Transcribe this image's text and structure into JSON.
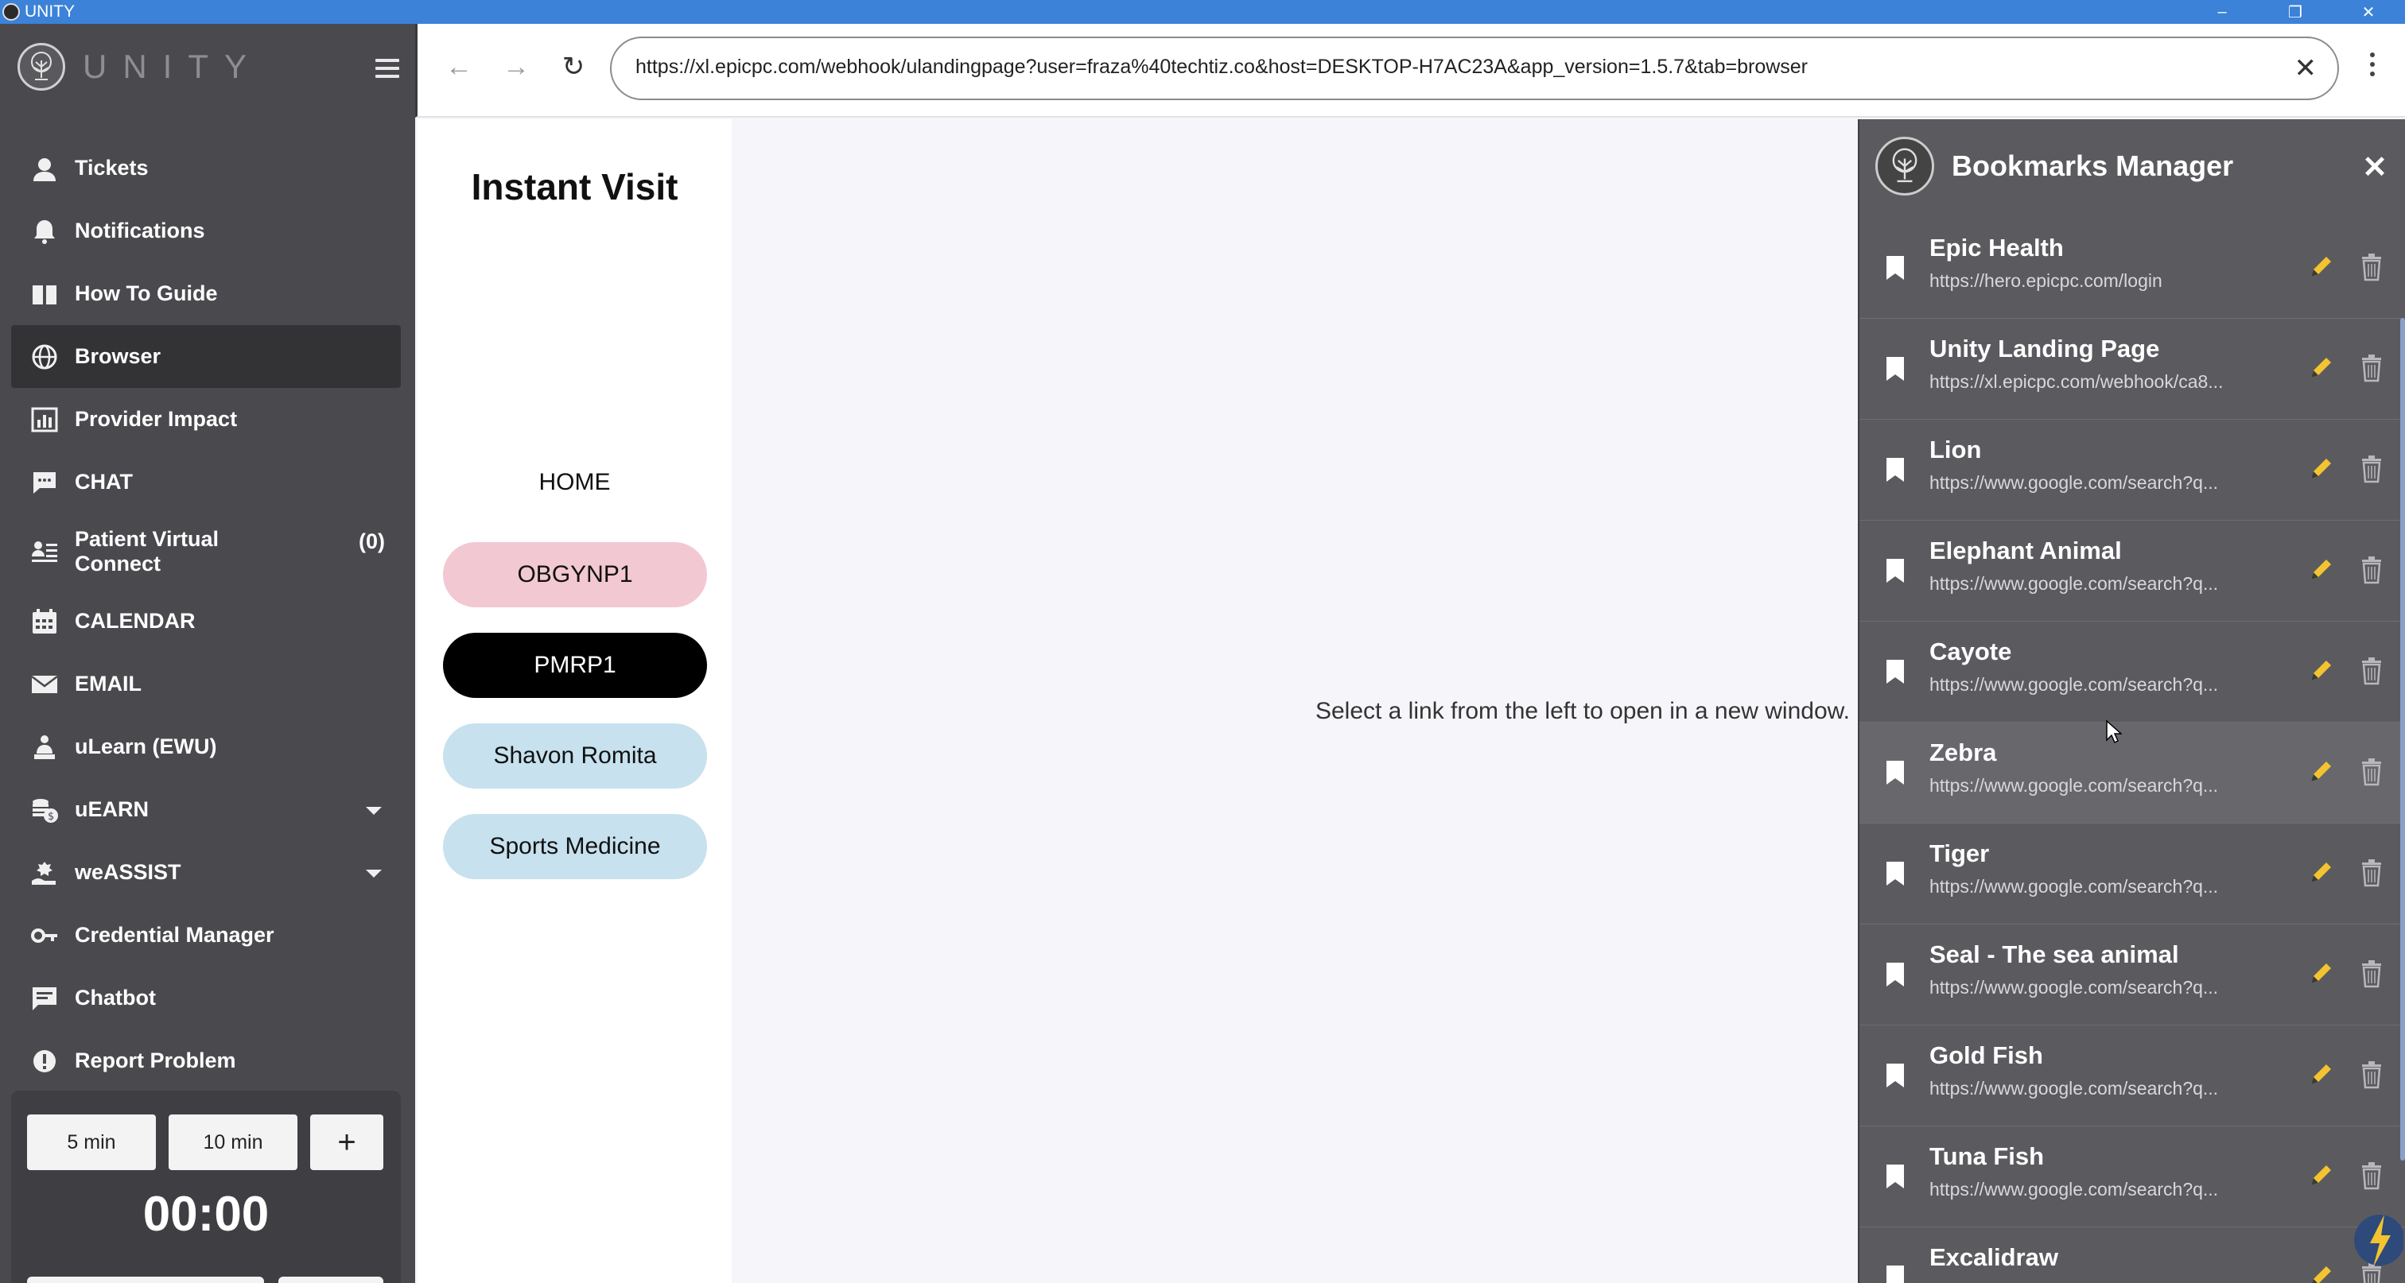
{
  "window": {
    "title": "UNITY",
    "controls": [
      "–",
      "❐",
      "✕"
    ]
  },
  "brand": {
    "name": "UNITY"
  },
  "sidebar": {
    "items": [
      {
        "label": "Tickets",
        "icon": "support-agent-icon"
      },
      {
        "label": "Notifications",
        "icon": "bell-icon"
      },
      {
        "label": "How To Guide",
        "icon": "book-icon"
      },
      {
        "label": "Browser",
        "icon": "globe-icon",
        "active": true
      },
      {
        "label": "Provider Impact",
        "icon": "chart-icon"
      },
      {
        "label": "CHAT",
        "icon": "chat-bubble-icon"
      },
      {
        "label": "Patient Virtual Connect",
        "icon": "people-list-icon",
        "count": "(0)"
      },
      {
        "label": "CALENDAR",
        "icon": "calendar-icon"
      },
      {
        "label": "EMAIL",
        "icon": "mail-icon"
      },
      {
        "label": "uLearn (EWU)",
        "icon": "learner-icon"
      },
      {
        "label": "uEARN",
        "icon": "coins-icon",
        "expandable": true
      },
      {
        "label": "weASSIST",
        "icon": "helping-hand-icon",
        "expandable": true
      },
      {
        "label": "Credential Manager",
        "icon": "key-icon"
      },
      {
        "label": "Chatbot",
        "icon": "message-icon"
      },
      {
        "label": "Report Problem",
        "icon": "alert-icon"
      }
    ]
  },
  "timer": {
    "preset1": "5 min",
    "preset2": "10 min",
    "add": "+",
    "display": "00:00"
  },
  "browser": {
    "url": "https://xl.epicpc.com/webhook/ulandingpage?user=fraza%40techtiz.co&host=DESKTOP-H7AC23A&app_version=1.5.7&tab=browser"
  },
  "page": {
    "heading": "Instant Visit",
    "home": "HOME",
    "links": [
      {
        "label": "OBGYNP1",
        "color": "#f2c8d3",
        "text": "#111111"
      },
      {
        "label": "PMRP1",
        "color": "#000000",
        "text": "#ffffff"
      },
      {
        "label": "Shavon Romita",
        "color": "#c7e1ee",
        "text": "#111111"
      },
      {
        "label": "Sports Medicine",
        "color": "#c7e1ee",
        "text": "#111111"
      }
    ],
    "message": "Select a link from the left to open in a new window."
  },
  "bookmarks": {
    "title": "Bookmarks Manager",
    "items": [
      {
        "name": "Epic Health",
        "url": "https://hero.epicpc.com/login"
      },
      {
        "name": "Unity Landing Page",
        "url": "https://xl.epicpc.com/webhook/ca8..."
      },
      {
        "name": "Lion",
        "url": "https://www.google.com/search?q..."
      },
      {
        "name": "Elephant Animal",
        "url": "https://www.google.com/search?q..."
      },
      {
        "name": "Cayote",
        "url": "https://www.google.com/search?q..."
      },
      {
        "name": "Zebra",
        "url": "https://www.google.com/search?q...",
        "hover": true
      },
      {
        "name": "Tiger",
        "url": "https://www.google.com/search?q..."
      },
      {
        "name": "Seal - The sea animal",
        "url": "https://www.google.com/search?q..."
      },
      {
        "name": "Gold Fish",
        "url": "https://www.google.com/search?q..."
      },
      {
        "name": "Tuna Fish",
        "url": "https://www.google.com/search?q..."
      },
      {
        "name": "Excalidraw",
        "url": ""
      }
    ]
  },
  "colors": {
    "titlebar": "#3b82d8",
    "sidebar": "#4a4a4e",
    "panel": "#5b5b5f",
    "edit": "#f4c430"
  }
}
